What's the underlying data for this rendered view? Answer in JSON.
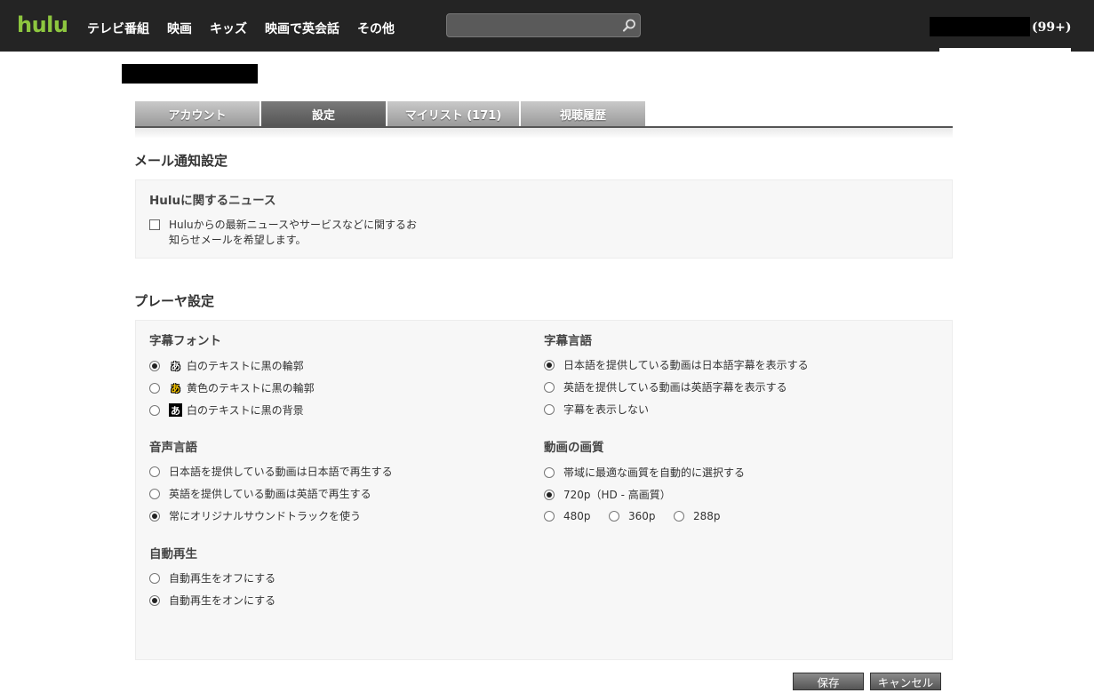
{
  "header": {
    "logo": "hulu",
    "nav": [
      "テレビ番組",
      "映画",
      "キッズ",
      "映画で英会話",
      "その他"
    ],
    "search": {
      "value": "",
      "placeholder": ""
    },
    "user_count": "(99+)"
  },
  "tabs": [
    {
      "label": "アカウント",
      "active": false
    },
    {
      "label": "設定",
      "active": true
    },
    {
      "label": "マイリスト (171)",
      "active": false
    },
    {
      "label": "視聴履歴",
      "active": false
    }
  ],
  "email_section": {
    "title": "メール通知設定",
    "group_title": "Huluに関するニュース",
    "checkbox_line1": "Huluからの最新ニュースやサービスなどに関するお",
    "checkbox_line2": "知らせメールを希望します。",
    "checked": false
  },
  "player_section": {
    "title": "プレーヤ設定",
    "subtitle_font": {
      "title": "字幕フォント",
      "sample": "あ",
      "options": [
        {
          "label": "白のテキストに黒の輪郭",
          "checked": true
        },
        {
          "label": "黄色のテキストに黒の輪郭",
          "checked": false
        },
        {
          "label": "白のテキストに黒の背景",
          "checked": false
        }
      ]
    },
    "subtitle_language": {
      "title": "字幕言語",
      "options": [
        {
          "label": "日本語を提供している動画は日本語字幕を表示する",
          "checked": true
        },
        {
          "label": "英語を提供している動画は英語字幕を表示する",
          "checked": false
        },
        {
          "label": "字幕を表示しない",
          "checked": false
        }
      ]
    },
    "audio_language": {
      "title": "音声言語",
      "options": [
        {
          "label": "日本語を提供している動画は日本語で再生する",
          "checked": false
        },
        {
          "label": "英語を提供している動画は英語で再生する",
          "checked": false
        },
        {
          "label": "常にオリジナルサウンドトラックを使う",
          "checked": true
        }
      ]
    },
    "video_quality": {
      "title": "動画の画質",
      "options": [
        {
          "label": "帯域に最適な画質を自動的に選択する",
          "checked": false
        },
        {
          "label": "720p（HD - 高画質）",
          "checked": true
        },
        {
          "label": "480p",
          "checked": false
        },
        {
          "label": "360p",
          "checked": false
        },
        {
          "label": "288p",
          "checked": false
        }
      ]
    },
    "autoplay": {
      "title": "自動再生",
      "options": [
        {
          "label": "自動再生をオフにする",
          "checked": false
        },
        {
          "label": "自動再生をオンにする",
          "checked": true
        }
      ]
    }
  },
  "buttons": {
    "save": "保存",
    "cancel": "キャンセル"
  }
}
